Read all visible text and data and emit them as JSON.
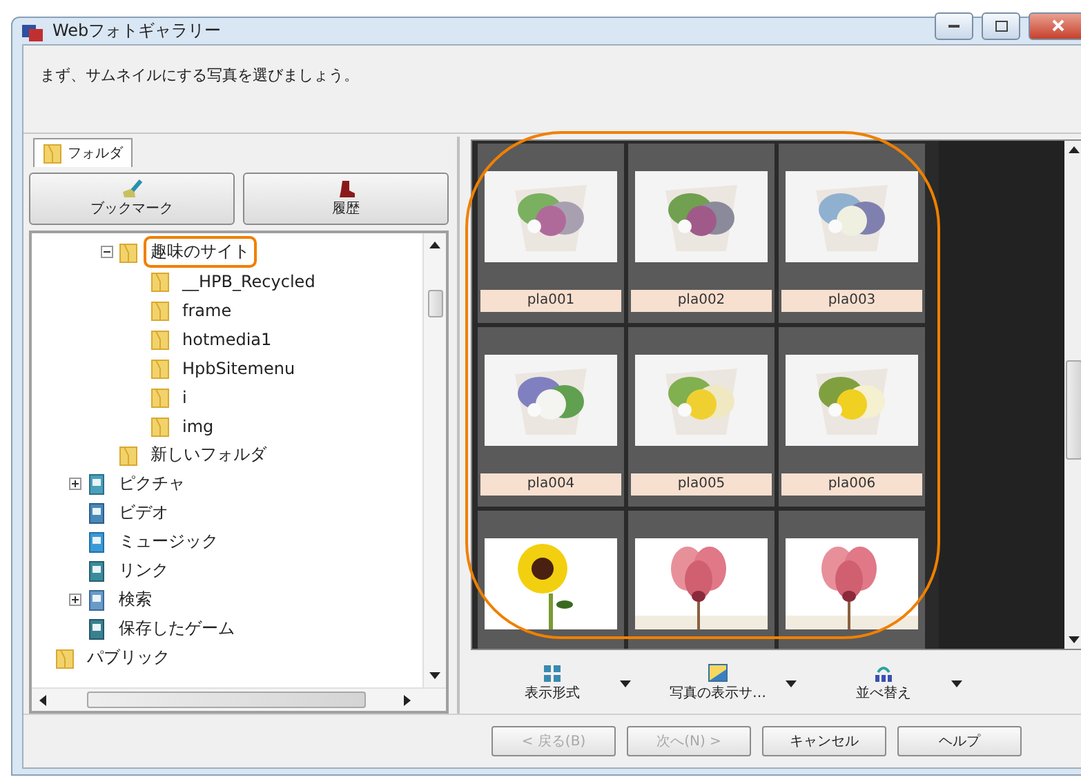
{
  "window": {
    "title": "Webフォトギャラリー"
  },
  "instruction": "まず、サムネイルにする写真を選びましょう。",
  "left_pane": {
    "tab": {
      "label": "フォルダ",
      "selected": true
    },
    "buttons": [
      {
        "label": "ブックマーク",
        "kind": "bookmark"
      },
      {
        "label": "履歴",
        "kind": "history"
      }
    ],
    "tree": [
      {
        "children": [
          {
            "children": [
              {
                "label": "趣味のサイト",
                "kind": "folder",
                "expanded": true,
                "highlighted": true,
                "children": [
                  {
                    "label": "__HPB_Recycled",
                    "kind": "folder"
                  },
                  {
                    "label": "frame",
                    "kind": "folder"
                  },
                  {
                    "label": "hotmedia1",
                    "kind": "folder"
                  },
                  {
                    "label": "HpbSitemenu",
                    "kind": "folder"
                  },
                  {
                    "label": "i",
                    "kind": "folder"
                  },
                  {
                    "label": "img",
                    "kind": "folder"
                  }
                ]
              },
              {
                "label": "新しいフォルダ",
                "kind": "folder"
              }
            ]
          },
          {
            "label": "ピクチャ",
            "kind": "pictures",
            "expanded": false
          },
          {
            "label": "ビデオ",
            "kind": "video"
          },
          {
            "label": "ミュージック",
            "kind": "music"
          },
          {
            "label": "リンク",
            "kind": "links"
          },
          {
            "label": "検索",
            "kind": "search",
            "expanded": false
          },
          {
            "label": "保存したゲーム",
            "kind": "games"
          }
        ]
      },
      {
        "label": "パブリック",
        "kind": "folder"
      }
    ]
  },
  "gallery": {
    "highlighted": true,
    "photos": [
      {
        "kind": "picture",
        "caption": "pla001"
      },
      {
        "kind": "picture",
        "caption": "pla002"
      },
      {
        "kind": "picture",
        "caption": "pla003"
      },
      {
        "kind": "picture",
        "caption": "pla004"
      },
      {
        "kind": "picture",
        "caption": "pla005"
      },
      {
        "kind": "picture",
        "caption": "pla006"
      },
      {
        "kind": "picture"
      },
      {
        "kind": "picture"
      },
      {
        "kind": "picture"
      }
    ]
  },
  "toolbar": [
    {
      "label": "表示形式",
      "kind": "view"
    },
    {
      "label": "写真の表示サ…",
      "kind": "size"
    },
    {
      "label": "並べ替え",
      "kind": "sort"
    }
  ],
  "buttons": [
    {
      "label": "< 戻る(B)",
      "disabled": true
    },
    {
      "label": "次へ(N) >",
      "disabled": true
    },
    {
      "label": "キャンセル",
      "disabled": false
    },
    {
      "label": "ヘルプ",
      "disabled": false
    }
  ]
}
